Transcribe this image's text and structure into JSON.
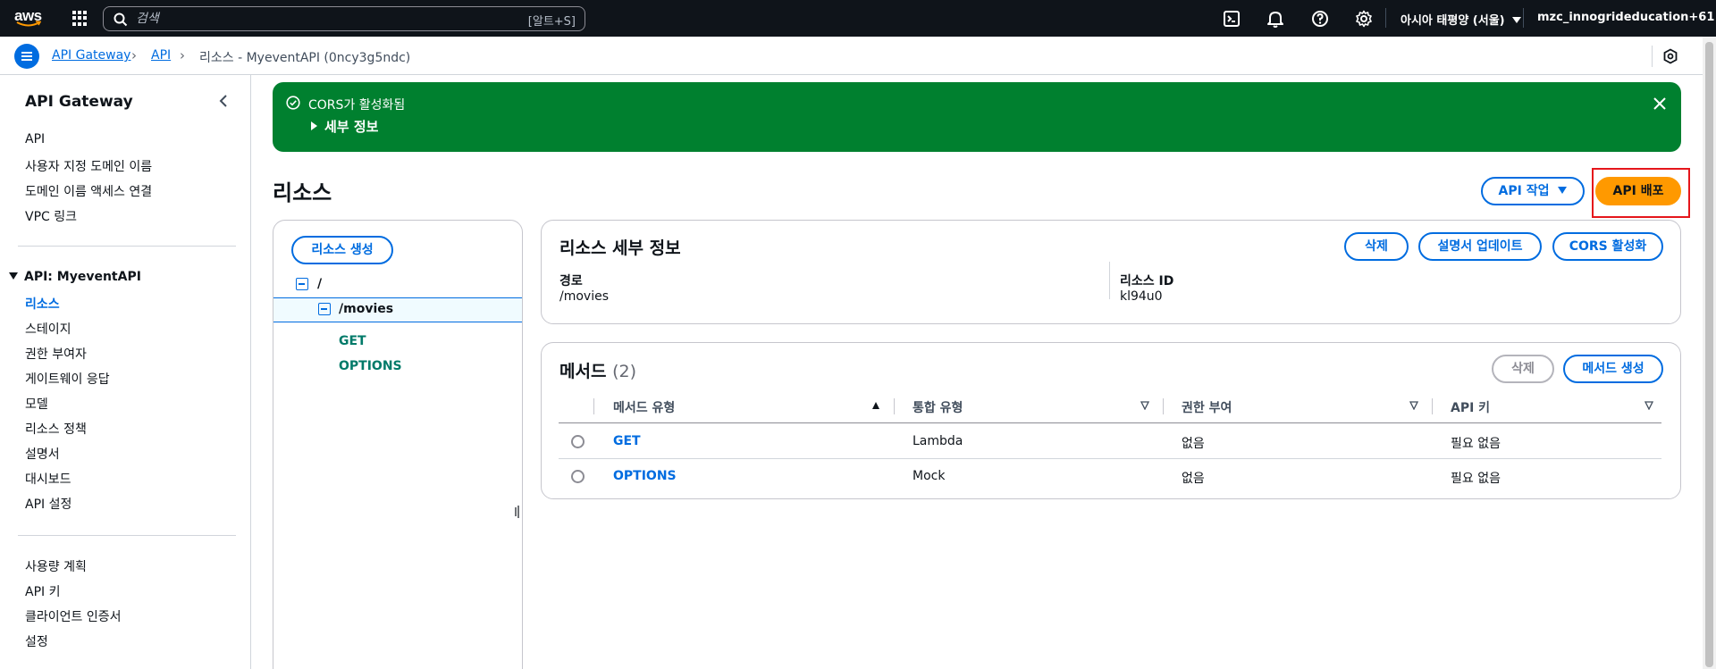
{
  "topnav": {
    "logo_text": "aws",
    "search_placeholder": "검색",
    "search_shortcut": "[알트+S]",
    "region": "아시아 태평양 (서울)",
    "account": "mzc_innogrideducation+61"
  },
  "breadcrumb": {
    "items": [
      "API Gateway",
      "API",
      "리소스 - MyeventAPI (0ncy3g5ndc)"
    ]
  },
  "sidebar": {
    "title": "API Gateway",
    "top_links": [
      "API",
      "사용자 지정 도메인 이름",
      "도메인 이름 액세스 연결",
      "VPC 링크"
    ],
    "section_title": "API: MyeventAPI",
    "api_links": [
      "리소스",
      "스테이지",
      "권한 부여자",
      "게이트웨이 응답",
      "모델",
      "리소스 정책",
      "설명서",
      "대시보드",
      "API 설정"
    ],
    "active_link": "리소스",
    "bottom_links": [
      "사용량 계획",
      "API 키",
      "클라이언트 인증서",
      "설정"
    ]
  },
  "flash": {
    "message": "CORS가 활성화됨",
    "details_label": "세부 정보",
    "color": "#00802f"
  },
  "header": {
    "title": "리소스",
    "api_actions_label": "API 작업",
    "deploy_label": "API 배포"
  },
  "tree": {
    "create_button": "리소스 생성",
    "root": "/",
    "child": "/movies",
    "methods": [
      "GET",
      "OPTIONS"
    ]
  },
  "details": {
    "title": "리소스 세부 정보",
    "delete_label": "삭제",
    "update_doc_label": "설명서 업데이트",
    "cors_label": "CORS 활성화",
    "path_label": "경로",
    "path_value": "/movies",
    "resource_id_label": "리소스 ID",
    "resource_id_value": "kl94u0"
  },
  "methods": {
    "title": "메서드",
    "count": "(2)",
    "delete_label": "삭제",
    "create_label": "메서드 생성",
    "columns": [
      "메서드 유형",
      "통합 유형",
      "권한 부여",
      "API 키"
    ],
    "rows": [
      {
        "method": "GET",
        "integration": "Lambda",
        "auth": "없음",
        "api_key": "필요 없음"
      },
      {
        "method": "OPTIONS",
        "integration": "Mock",
        "auth": "없음",
        "api_key": "필요 없음"
      }
    ]
  },
  "colors": {
    "accent": "#006ce0",
    "primary_button": "#ff9900",
    "method_link": "#007a69",
    "highlight_border": "#e5161b"
  }
}
